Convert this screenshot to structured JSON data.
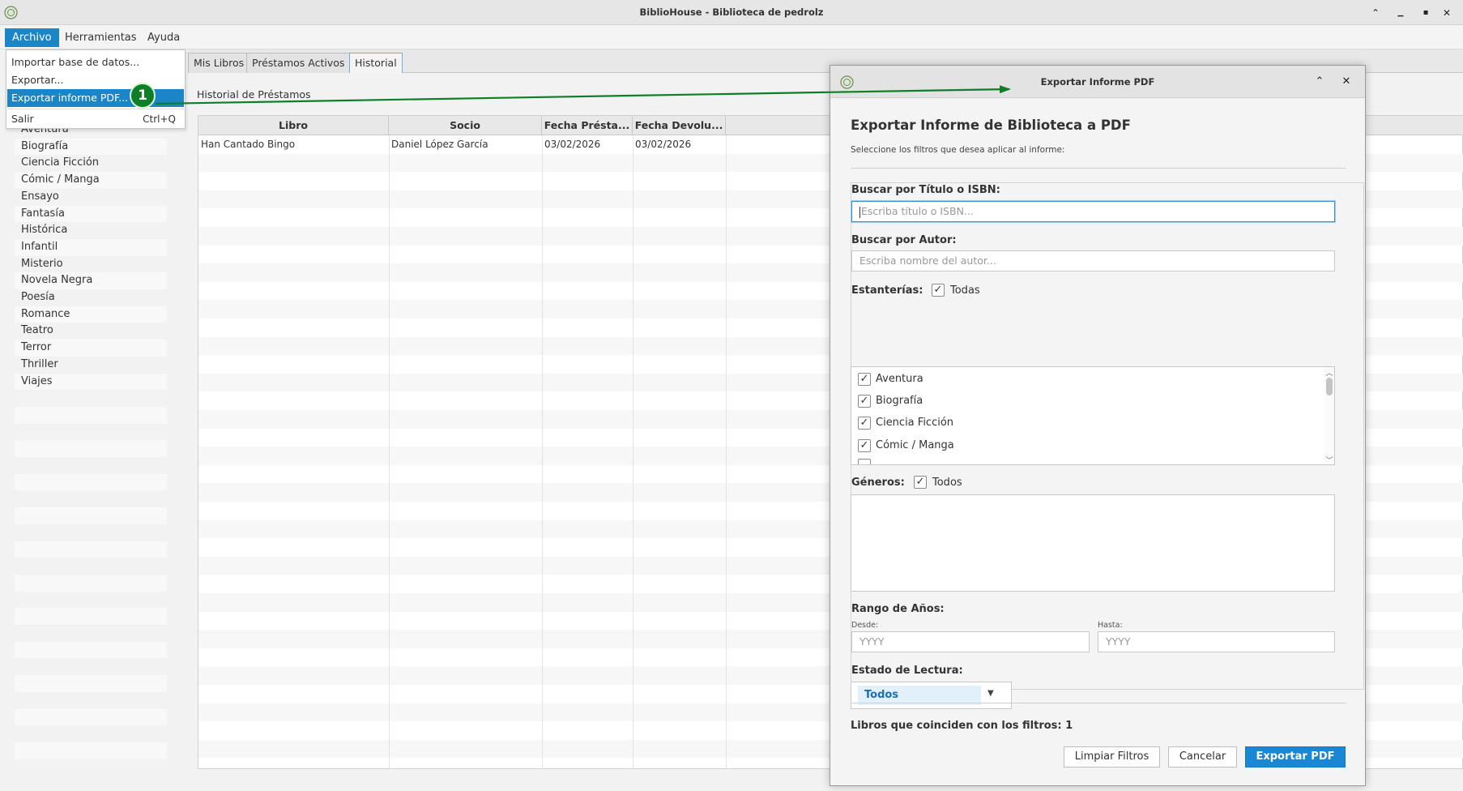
{
  "window": {
    "title": "BiblioHouse - Biblioteca de pedrolz",
    "controls": {
      "minimize": "⌃",
      "restore": "▁",
      "maximize": "▪",
      "close": "✕"
    }
  },
  "menubar": {
    "items": [
      {
        "label": "Archivo",
        "active": true
      },
      {
        "label": "Herramientas",
        "active": false
      },
      {
        "label": "Ayuda",
        "active": false
      }
    ]
  },
  "file_menu": {
    "items": [
      {
        "label": "Importar base de datos...",
        "shortcut": ""
      },
      {
        "label": "Exportar...",
        "shortcut": ""
      },
      {
        "label": "Exportar informe PDF...",
        "shortcut": "",
        "selected": true
      },
      {
        "label": "Salir",
        "shortcut": "Ctrl+Q"
      }
    ]
  },
  "tabs": [
    {
      "label": "Mis Libros",
      "active": false
    },
    {
      "label": "Préstamos Activos",
      "active": false
    },
    {
      "label": "Historial",
      "active": true
    }
  ],
  "categories": [
    "Aventura",
    "Biografía",
    "Ciencia Ficción",
    "Cómic / Manga",
    "Ensayo",
    "Fantasía",
    "Histórica",
    "Infantil",
    "Misterio",
    "Novela Negra",
    "Poesía",
    "Romance",
    "Teatro",
    "Terror",
    "Thriller",
    "Viajes"
  ],
  "history": {
    "label": "Historial de Préstamos",
    "columns": [
      "Libro",
      "Socio",
      "Fecha Présta...",
      "Fecha Devolu..."
    ],
    "rows": [
      [
        "Han Cantado Bingo",
        "Daniel López García",
        "03/02/2026",
        "03/02/2026"
      ]
    ]
  },
  "annotation": {
    "marker": "1",
    "color": "#0e7f26"
  },
  "dialog": {
    "title": "Exportar Informe PDF",
    "controls": {
      "collapse": "⌃",
      "close": "✕"
    },
    "heading": "Exportar Informe de Biblioteca a PDF",
    "subtitle": "Seleccione los filtros que desea aplicar al informe:",
    "title_search": {
      "label": "Buscar por Título o ISBN:",
      "placeholder": "Escriba título o ISBN..."
    },
    "author_search": {
      "label": "Buscar por Autor:",
      "placeholder": "Escriba nombre del autor..."
    },
    "shelves": {
      "label": "Estanterías:",
      "all_label": "Todas",
      "all_checked": true,
      "items": [
        {
          "label": "Aventura",
          "checked": true
        },
        {
          "label": "Biografía",
          "checked": true
        },
        {
          "label": "Ciencia Ficción",
          "checked": true
        },
        {
          "label": "Cómic / Manga",
          "checked": true
        }
      ]
    },
    "genres": {
      "label": "Géneros:",
      "all_label": "Todos",
      "all_checked": true
    },
    "year_range": {
      "label": "Rango de Años:",
      "from_label": "Desde:",
      "from_placeholder": "YYYY",
      "to_label": "Hasta:",
      "to_placeholder": "YYYY"
    },
    "reading_state": {
      "label": "Estado de Lectura:",
      "value": "Todos"
    },
    "match_count": "Libros que coinciden con los filtros: 1",
    "buttons": {
      "clear": "Limpiar Filtros",
      "cancel": "Cancelar",
      "export": "Exportar PDF"
    }
  },
  "colors": {
    "accent": "#1a86c7",
    "primary_button": "#1a86d4",
    "annotation": "#0e7f26"
  }
}
